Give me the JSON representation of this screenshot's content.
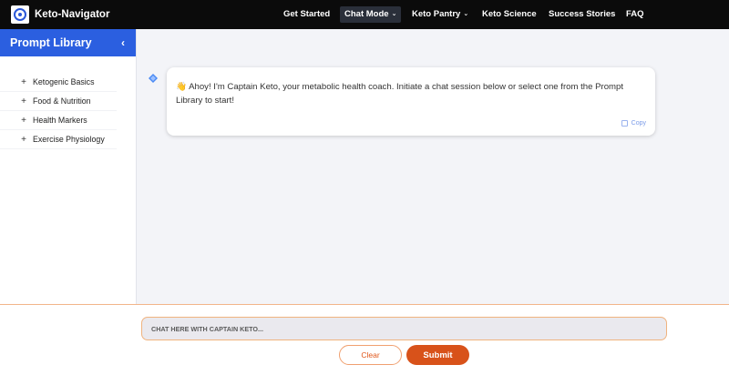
{
  "brand": {
    "name": "Keto-Navigator",
    "logo_icon": "navigator-logo-icon"
  },
  "nav": {
    "items": [
      {
        "label": "Get Started",
        "has_dropdown": false,
        "active": false
      },
      {
        "label": "Chat Mode",
        "has_dropdown": true,
        "active": true
      },
      {
        "label": "Keto Pantry",
        "has_dropdown": true,
        "active": false
      },
      {
        "label": "Keto Science",
        "has_dropdown": false,
        "active": false
      },
      {
        "label": "Success Stories",
        "has_dropdown": false,
        "active": false
      },
      {
        "label": "FAQ",
        "has_dropdown": false,
        "active": false
      }
    ],
    "chevron": "⌄"
  },
  "sidebar": {
    "title": "Prompt Library",
    "collapse_glyph": "‹",
    "items": [
      {
        "label": "Ketogenic Basics"
      },
      {
        "label": "Food & Nutrition"
      },
      {
        "label": "Health Markers"
      },
      {
        "label": "Exercise Physiology"
      }
    ],
    "item_glyph": "+"
  },
  "chat": {
    "message": "👋 Ahoy! I'm Captain Keto, your metabolic health coach. Initiate a chat session below or select one from the Prompt Library to start!",
    "copy_label": "Copy"
  },
  "composer": {
    "placeholder": "CHAT HERE WITH CAPTAIN KETO...",
    "value": "",
    "clear_label": "Clear",
    "submit_label": "Submit"
  },
  "colors": {
    "nav_bg": "#0b0b0b",
    "sidebar_header": "#2b5fe0",
    "accent": "#d8521a",
    "chat_icon": "#4a8af4"
  }
}
